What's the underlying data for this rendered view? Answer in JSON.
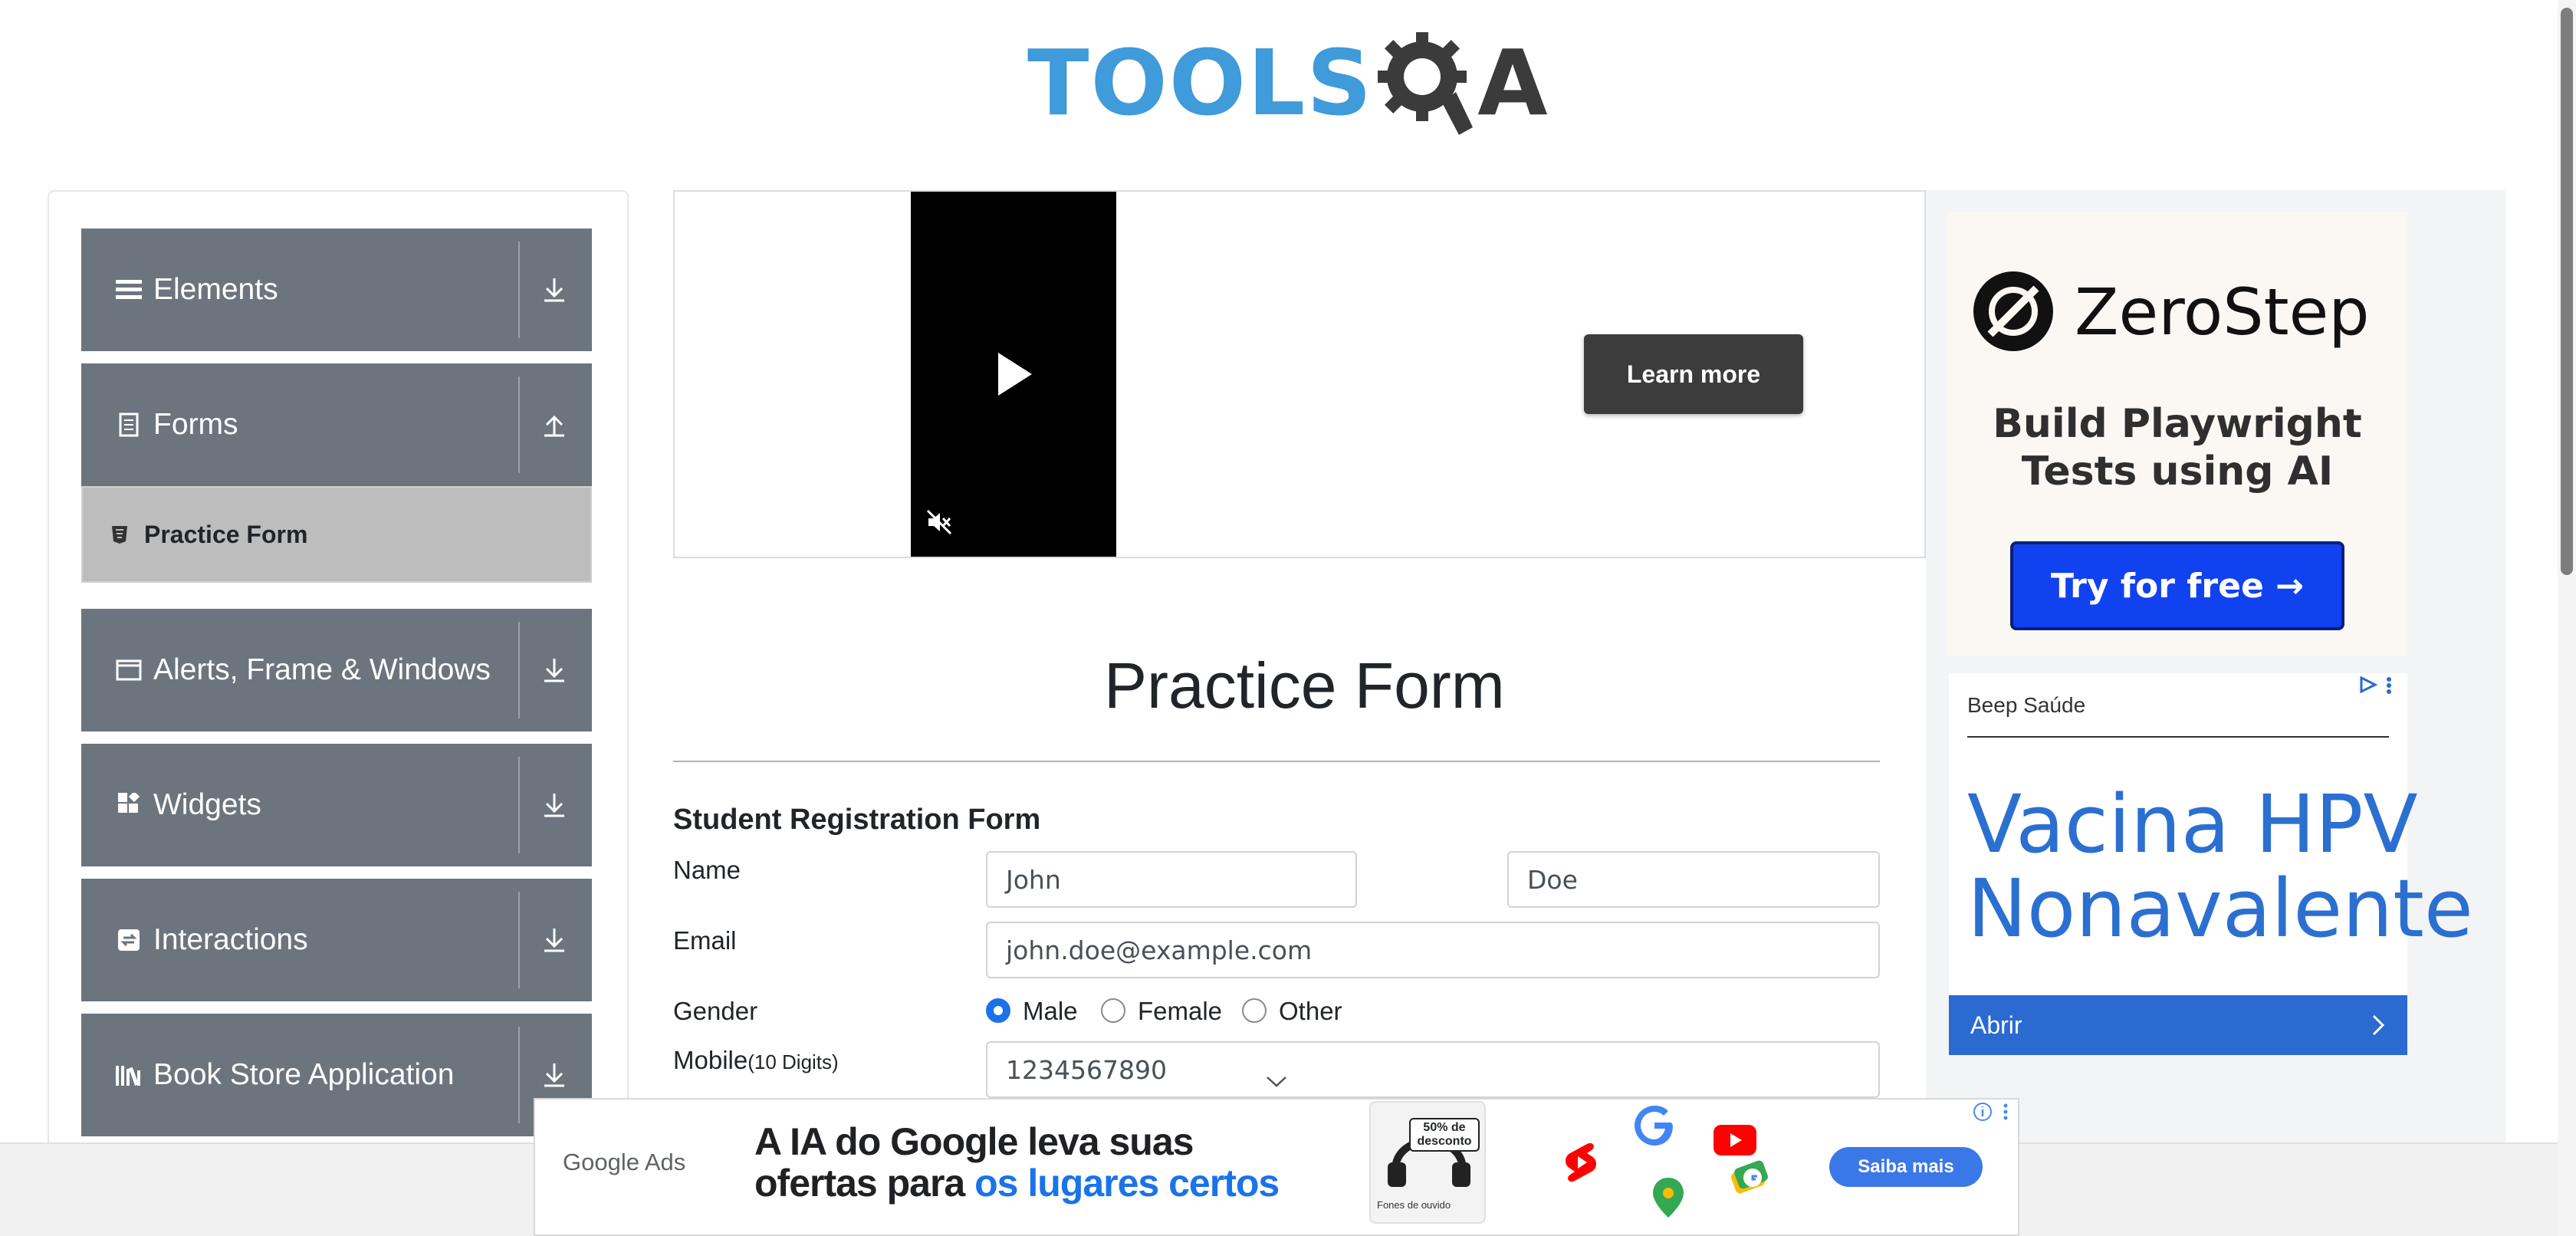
{
  "header": {
    "logo_tools": "TOOLS",
    "logo_q": "Q",
    "logo_a": "A"
  },
  "sidebar": {
    "groups": [
      {
        "label": "Elements",
        "icon": "menu-icon",
        "state": "collapsed"
      },
      {
        "label": "Forms",
        "icon": "document-icon",
        "state": "expanded"
      },
      {
        "label": "Alerts, Frame & Windows",
        "icon": "window-icon",
        "state": "collapsed"
      },
      {
        "label": "Widgets",
        "icon": "widgets-icon",
        "state": "collapsed"
      },
      {
        "label": "Interactions",
        "icon": "interactions-icon",
        "state": "collapsed"
      },
      {
        "label": "Book Store Application",
        "icon": "books-icon",
        "state": "collapsed"
      }
    ],
    "active_item": {
      "label": "Practice Form",
      "icon": "html5-icon"
    }
  },
  "video_ad": {
    "button": "Learn more",
    "muted": true
  },
  "right_ad": {
    "zerostep": {
      "brand": "ZeroStep",
      "tagline_1": "Build Playwright",
      "tagline_2": "Tests using AI",
      "cta": "Try for free →"
    },
    "beep": {
      "advertiser": "Beep Saúde",
      "headline_1": "Vacina HPV",
      "headline_2": "Nonavalente",
      "cta": "Abrir"
    }
  },
  "form": {
    "page_title": "Practice Form",
    "section_title": "Student Registration Form",
    "name_label": "Name",
    "first_name": "John",
    "last_name": "Doe",
    "email_label": "Email",
    "email": "john.doe@example.com",
    "gender_label": "Gender",
    "gender_options": [
      "Male",
      "Female",
      "Other"
    ],
    "gender_selected": "Male",
    "mobile_label": "Mobile",
    "mobile_hint": "(10 Digits)",
    "mobile": "1234567890"
  },
  "bottom_ad": {
    "brand": "Google Ads",
    "headline_1": "A IA do Google leva suas",
    "headline_2_prefix": "ofertas para ",
    "headline_2_highlight": "os lugares certos",
    "promo_badge": "50% de desconto",
    "promo_caption": "Fones de ouvido",
    "cta": "Saiba mais"
  },
  "colors": {
    "sidebar_group": "#6c757d",
    "active_item": "#bdbdbd",
    "logo_blue": "#3f9bd9",
    "cta_blue": "#1142f0",
    "radio_selected": "#1a73e8"
  }
}
